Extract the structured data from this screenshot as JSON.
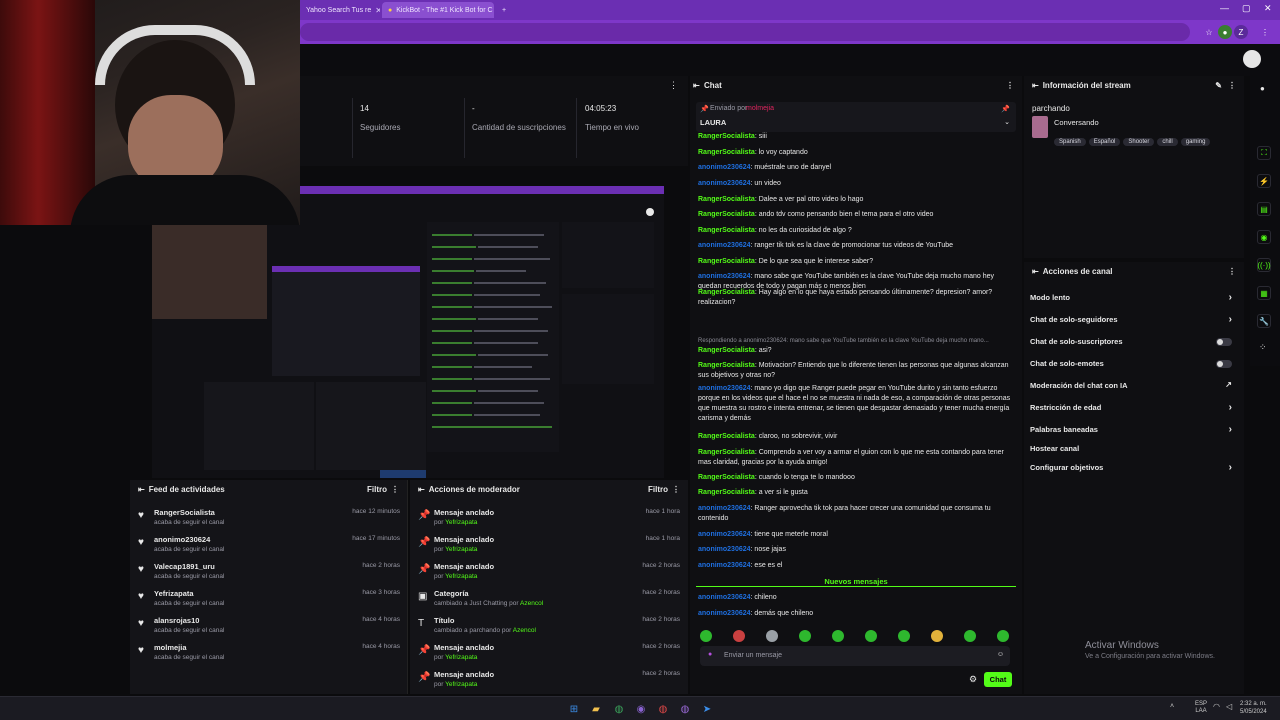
{
  "browser": {
    "tabs": [
      {
        "label": "Yahoo Search Tus re"
      },
      {
        "label": "KickBot - The #1 Kick Bot for C"
      }
    ],
    "new_tab": "+"
  },
  "stats": [
    {
      "value": "14",
      "label": "Seguidores"
    },
    {
      "value": "-",
      "label": "Cantidad de suscripciones"
    },
    {
      "value": "04:05:23",
      "label": "Tiempo en vivo"
    }
  ],
  "activity_feed": {
    "title": "Feed de actividades",
    "filter": "Filtro",
    "items": [
      {
        "name": "RangerSocialista",
        "sub": "acaba de seguir el canal",
        "time": "hace 12 minutos"
      },
      {
        "name": "anonimo230624",
        "sub": "acaba de seguir el canal",
        "time": "hace 17 minutos"
      },
      {
        "name": "Valecap1891_uru",
        "sub": "acaba de seguir el canal",
        "time": "hace 2 horas"
      },
      {
        "name": "Yefrizapata",
        "sub": "acaba de seguir el canal",
        "time": "hace 3 horas"
      },
      {
        "name": "alansrojas10",
        "sub": "acaba de seguir el canal",
        "time": "hace 4 horas"
      },
      {
        "name": "molmejia",
        "sub": "acaba de seguir el canal",
        "time": "hace 4 horas"
      }
    ]
  },
  "mod_actions": {
    "title": "Acciones de moderador",
    "filter": "Filtro",
    "items": [
      {
        "name": "Mensaje anclado",
        "by": "por",
        "user": "Yefrizapata",
        "time": "hace 1 hora"
      },
      {
        "name": "Mensaje anclado",
        "by": "por",
        "user": "Yefrizapata",
        "time": "hace 1 hora"
      },
      {
        "name": "Mensaje anclado",
        "by": "por",
        "user": "Yefrizapata",
        "time": "hace 2 horas"
      },
      {
        "name": "Categoría",
        "by": "cambiado a Just Chatting por",
        "user": "Azencol",
        "time": "hace 2 horas"
      },
      {
        "name": "Título",
        "by": "cambiado a parchando por",
        "user": "Azencol",
        "time": "hace 2 horas"
      },
      {
        "name": "Mensaje anclado",
        "by": "por",
        "user": "Yefrizapata",
        "time": "hace 2 horas"
      },
      {
        "name": "Mensaje anclado",
        "by": "por",
        "user": "Yefrizapata",
        "time": "hace 2 horas"
      }
    ]
  },
  "chat": {
    "title": "Chat",
    "pinned_by": "Enviado por",
    "pinned_user": "molmejia",
    "pinned_text": "LAURA",
    "messages": [
      {
        "user": "RangerSocialista",
        "text": ": siii",
        "anon": false
      },
      {
        "user": "RangerSocialista",
        "text": ": lo voy captando",
        "anon": false
      },
      {
        "user": "anonimo230624",
        "text": ": muéstrale uno de danyel",
        "anon": true
      },
      {
        "user": "anonimo230624",
        "text": ": un video",
        "anon": true
      },
      {
        "user": "RangerSocialista",
        "text": ": Dalee a ver pal otro video lo hago",
        "anon": false
      },
      {
        "user": "RangerSocialista",
        "text": ": ando tdv como pensando bien el tema para el otro video",
        "anon": false
      },
      {
        "user": "RangerSocialista",
        "text": ": no les da curiosidad de algo ?",
        "anon": false
      },
      {
        "user": "anonimo230624",
        "text": ": ranger tik tok es la clave de promocionar tus videos de YouTube",
        "anon": true
      },
      {
        "user": "RangerSocialista",
        "text": ": De lo que sea que le interese saber?",
        "anon": false
      },
      {
        "user": "anonimo230624",
        "text": ": mano sabe que YouTube también es la clave YouTube deja mucho mano hey quedan recuerdos de todo y pagan más o menos bien",
        "anon": true
      },
      {
        "user": "RangerSocialista",
        "text": ": Hay algo en lo que haya estado pensando últimamente? depresion? amor? realizacion?",
        "anon": false
      },
      {
        "user": "RangerSocialista",
        "text": ": asi?",
        "anon": false
      },
      {
        "user": "RangerSocialista",
        "text": ": Motivacion? Entiendo que lo diferente tienen las personas que algunas alcanzan sus objetivos y otras no?",
        "anon": false
      },
      {
        "user": "anonimo230624",
        "text": ": mano yo digo que Ranger puede pegar en YouTube durito y sin tanto esfuerzo porque en los videos que el hace el no se muestra ni nada de eso, a comparación de otras personas que muestra su rostro e intenta entrenar, se tienen que desgastar demasiado y tener mucha energía carisma y demás",
        "anon": true
      },
      {
        "user": "RangerSocialista",
        "text": ": claroo, no sobrevivir, vivir",
        "anon": false
      },
      {
        "user": "RangerSocialista",
        "text": ": Comprendo a ver voy a armar el guion con lo que me esta contando para tener mas claridad, gracias por la ayuda amigo!",
        "anon": false
      },
      {
        "user": "RangerSocialista",
        "text": ": cuando lo tenga te lo mandooo",
        "anon": false
      },
      {
        "user": "RangerSocialista",
        "text": ": a ver si le gusta",
        "anon": false
      },
      {
        "user": "anonimo230624",
        "text": ": Ranger aprovecha tik tok para hacer crecer una comunidad que consuma tu contenido",
        "anon": true
      },
      {
        "user": "anonimo230624",
        "text": ": tiene que meterle moral",
        "anon": true
      },
      {
        "user": "anonimo230624",
        "text": ": nose jajas",
        "anon": true
      },
      {
        "user": "anonimo230624",
        "text": ": ese es el",
        "anon": true
      }
    ],
    "reply_notice": "Respondiendo a anonimo230624: mano sabe que YouTube también es la clave YouTube deja mucho mano...",
    "new_messages": "Nuevos mensajes",
    "after_messages": [
      {
        "user": "anonimo230624",
        "text": ": chileno",
        "anon": true
      },
      {
        "user": "anonimo230624",
        "text": ": demás que chileno",
        "anon": true
      }
    ],
    "input_placeholder": "Enviar un mensaje",
    "send": "Chat"
  },
  "stream_info": {
    "title": "Información del stream",
    "stream_title": "parchando",
    "category": "Conversando",
    "tags": [
      "Spanish",
      "Español",
      "Shooter",
      "chill",
      "gaming"
    ]
  },
  "channel_actions": {
    "title": "Acciones de canal",
    "items": [
      {
        "label": "Modo lento",
        "kind": "chevron"
      },
      {
        "label": "Chat de solo-seguidores",
        "kind": "chevron"
      },
      {
        "label": "Chat de solo-suscriptores",
        "kind": "toggle"
      },
      {
        "label": "Chat de solo-emotes",
        "kind": "toggle"
      },
      {
        "label": "Moderación del chat con IA",
        "kind": "ext"
      },
      {
        "label": "Restricción de edad",
        "kind": "chevron"
      },
      {
        "label": "Palabras baneadas",
        "kind": "chevron"
      },
      {
        "label": "Hostear canal",
        "kind": "none"
      },
      {
        "label": "Configurar objetivos",
        "kind": "chevron"
      }
    ]
  },
  "watermark": {
    "title": "Activar Windows",
    "subtitle": "Ve a Configuración para activar Windows."
  },
  "taskbar": {
    "lang": "ESP LAA",
    "time": "2:32 a. m.",
    "date": "5/05/2024"
  },
  "colors": {
    "accent": "#53fc18",
    "browser": "#7e37c9",
    "anon_user": "#1f6fe0"
  }
}
